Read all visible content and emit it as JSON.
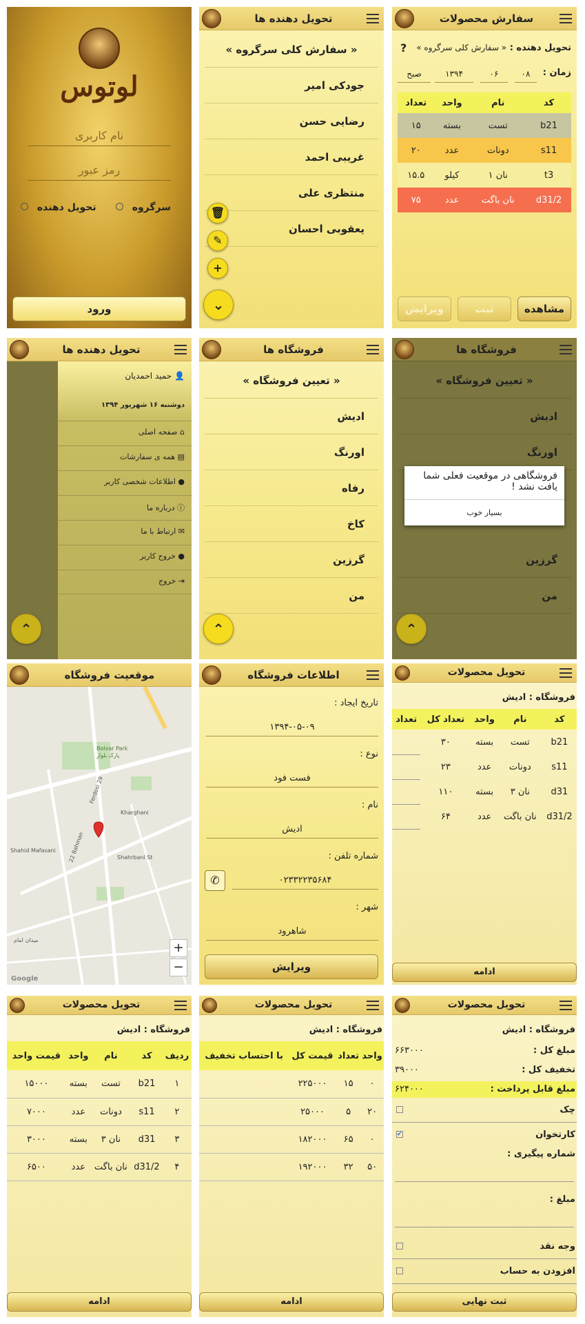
{
  "login": {
    "logo_text": "لوتوس",
    "username_placeholder": "نام کاربری",
    "password_placeholder": "رمز عبور",
    "role_group": "سرگروه",
    "role_delivery": "تحویل دهنده",
    "login_button": "ورود"
  },
  "deliverers": {
    "title": "تحویل دهنده ها",
    "order_all": "« سفارش کلی سرگروه »",
    "items": [
      "جودکی امیر",
      "رضایی حسن",
      "غریبی احمد",
      "منتظری علی",
      "یعقوبی احسان"
    ]
  },
  "order": {
    "title": "سفارش محصولات",
    "deliverer_label": "تحویل دهنده :",
    "deliverer_value": "« سفارش کلی سرگروه »",
    "help": "?",
    "time_label": "زمان :",
    "day": "۰۸",
    "month": "۰۶",
    "year": "۱۳۹۴",
    "ampm": "صبح",
    "columns": [
      "کد",
      "نام",
      "واحد",
      "تعداد"
    ],
    "rows": [
      [
        "b21",
        "تست",
        "بسته",
        "۱۵"
      ],
      [
        "s11",
        "دونات",
        "عدد",
        "۲۰"
      ],
      [
        "t3",
        "نان ۱",
        "کیلو",
        "۱۵.۵"
      ],
      [
        "d31/2",
        "نان باگت",
        "عدد",
        "۷۵"
      ]
    ],
    "row_colors": [
      "#c7c6a0",
      "#f7c64a",
      "#f6ee9e",
      "#f56f4e"
    ],
    "buttons": {
      "view": "مشاهده",
      "save": "ثبت",
      "edit": "ویرایش"
    }
  },
  "drawer": {
    "title": "تحویل دهنده ها",
    "user": "حمید احمدیان",
    "date": "دوشنبه ۱۶ شهریور ۱۳۹۴",
    "items": [
      "صفحه اصلی",
      "همه ی سفارشات",
      "اطلاعات شخصی کاربر",
      "درباره ما",
      "ارتباط با ما",
      "خروج کاربر",
      "خروج"
    ]
  },
  "stores": {
    "title": "فروشگاه ها",
    "select": "« تعیین فروشگاه »",
    "items": [
      "ادیش",
      "اورنگ",
      "رفاه",
      "کاخ",
      "گرزین",
      "من"
    ]
  },
  "dialog": {
    "message": "فروشگاهی در موقعیت فعلی شما یافت نشد !",
    "ok": "بسیار خوب"
  },
  "map": {
    "title": "موقعیت فروشگاه",
    "zoom_in": "+",
    "zoom_out": "−",
    "park": "Bolvar Park",
    "park_fa": "پارک بلوار",
    "google": "Google",
    "streets": [
      "Ferdosi 29",
      "Kharghani",
      "22 Bahman",
      "Shahid Mafasani",
      "Shahrbani St",
      "میدان امام"
    ]
  },
  "store_info": {
    "title": "اطلاعات فروشگاه",
    "created_label": "تاریخ ایجاد :",
    "created_value": "۱۳۹۴-۰۵-۰۹",
    "type_label": "نوع :",
    "type_value": "فست فود",
    "name_label": "نام :",
    "name_value": "ادیش",
    "phone_label": "شماره تلفن :",
    "phone_value": "۰۲۳۳۲۲۳۵۶۸۴",
    "city_label": "شهر :",
    "city_value": "شاهرود",
    "edit_button": "ویرایش"
  },
  "deliver1": {
    "title": "تحویل محصولات",
    "store": "فروشگاه : ادیش",
    "columns": [
      "کد",
      "نام",
      "واحد",
      "تعداد کل",
      "تعداد"
    ],
    "rows": [
      [
        "b21",
        "تست",
        "بسته",
        "۳۰"
      ],
      [
        "s11",
        "دونات",
        "عدد",
        "۲۳"
      ],
      [
        "d31",
        "نان ۳",
        "بسته",
        "۱۱۰"
      ],
      [
        "d31/2",
        "نان باگت",
        "عدد",
        "۶۴"
      ]
    ],
    "continue": "ادامه"
  },
  "deliver2": {
    "title": "تحویل محصولات",
    "store": "فروشگاه : ادیش",
    "columns": [
      "ردیف",
      "کد",
      "نام",
      "واحد",
      "قیمت واحد"
    ],
    "rows": [
      [
        "۱",
        "b21",
        "تست",
        "بسته",
        "۱۵۰۰۰"
      ],
      [
        "۲",
        "s11",
        "دونات",
        "عدد",
        "۷۰۰۰"
      ],
      [
        "۳",
        "d31",
        "نان ۳",
        "بسته",
        "۳۰۰۰"
      ],
      [
        "۴",
        "d31/2",
        "نان باگت",
        "عدد",
        "۶۵۰۰"
      ]
    ],
    "continue": "ادامه"
  },
  "deliver3": {
    "title": "تحویل محصولات",
    "store": "فروشگاه : ادیش",
    "columns": [
      "واحد",
      "تعداد",
      "قیمت کل",
      "با احتساب تخفیف"
    ],
    "rows": [
      [
        "۰",
        "۱۵",
        "۲۲۵۰۰۰",
        ""
      ],
      [
        "۲۰",
        "۵",
        "۲۵۰۰۰",
        ""
      ],
      [
        "۰",
        "۶۵",
        "۱۸۲۰۰۰",
        ""
      ],
      [
        "۵۰",
        "۳۲",
        "۱۹۲۰۰۰",
        ""
      ]
    ],
    "continue": "ادامه"
  },
  "deliver4": {
    "title": "تحویل محصولات",
    "store": "فروشگاه : ادیش",
    "total_label": "مبلغ کل :",
    "total": "۶۶۳۰۰۰",
    "discount_label": "تخفیف کل :",
    "discount": "۳۹۰۰۰",
    "payable_label": "مبلغ قابل پرداخت :",
    "payable": "۶۲۴۰۰۰",
    "check": "چک",
    "card": "کارتخوان",
    "tracking": "شماره پیگیری :",
    "amount": "مبلغ :",
    "cash": "وجه نقد",
    "account": "افزودن به حساب",
    "submit": "ثبت نهایی"
  }
}
